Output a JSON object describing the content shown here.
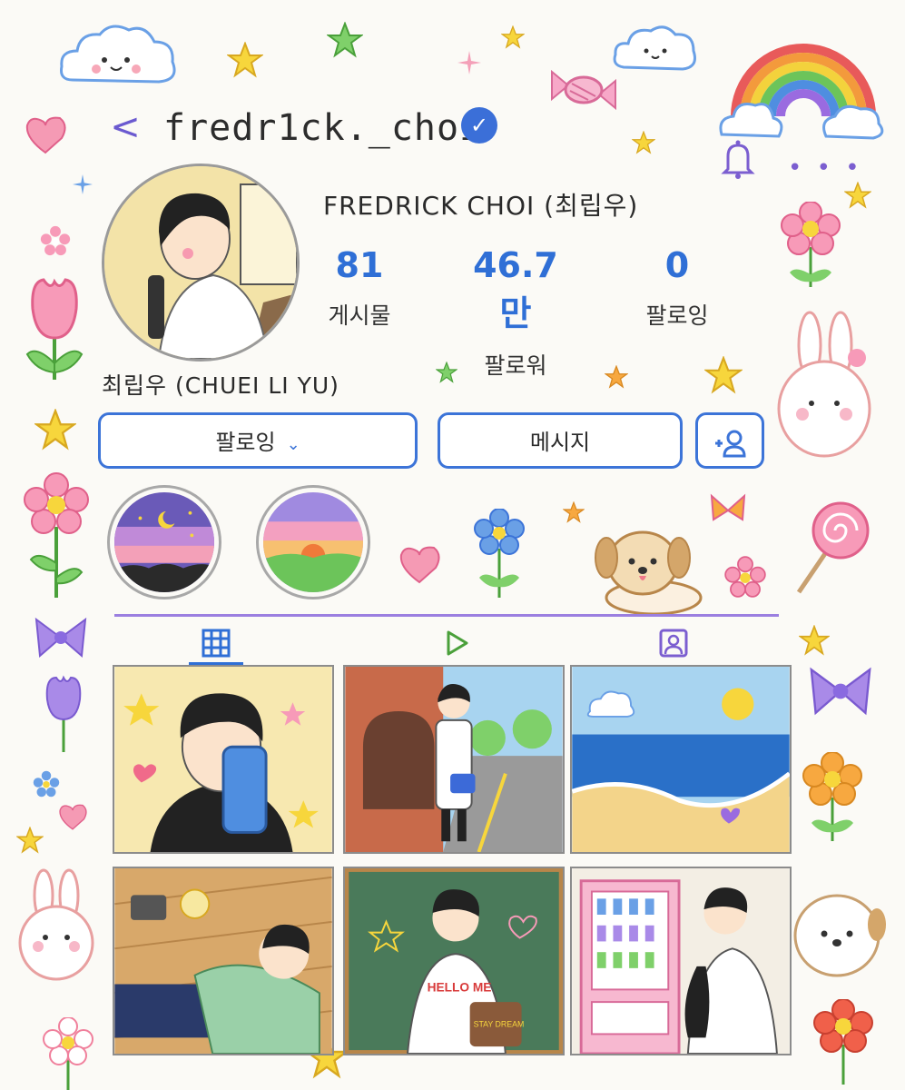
{
  "header": {
    "username": "fredr1ck._choi",
    "back_icon": "chevron-left-icon",
    "verified_icon": "verified-badge-icon",
    "notification_icon": "bell-icon",
    "more_icon": "more-dots-icon",
    "more_glyph": "• • •",
    "back_glyph": "<",
    "verified_glyph": "✓"
  },
  "profile": {
    "display_name": "FREDRICK CHOI (최립우)",
    "bio_name": "최립우 (CHUEI LI YU)",
    "stats": [
      {
        "value": "81",
        "label": "게시물"
      },
      {
        "value": "46.7만",
        "label": "팔로워"
      },
      {
        "value": "0",
        "label": "팔로잉"
      }
    ]
  },
  "actions": {
    "following_label": "팔로잉",
    "following_chevron": "⌄",
    "message_label": "메시지",
    "add_person_glyph": "+👤"
  },
  "highlights": [
    {
      "name": "night-sky-highlight"
    },
    {
      "name": "sunset-highlight"
    }
  ],
  "tabs": [
    {
      "name": "grid-icon",
      "active": true
    },
    {
      "name": "reels-play-icon",
      "active": false
    },
    {
      "name": "tagged-person-icon",
      "active": false
    }
  ],
  "posts": {
    "post_5_text": "HELLO ME",
    "post_5_bag_text": "STAY DREAM"
  },
  "colors": {
    "accent_blue": "#2f6fd6",
    "divider_purple": "#9b7fe0",
    "background": "#fbfaf6"
  }
}
